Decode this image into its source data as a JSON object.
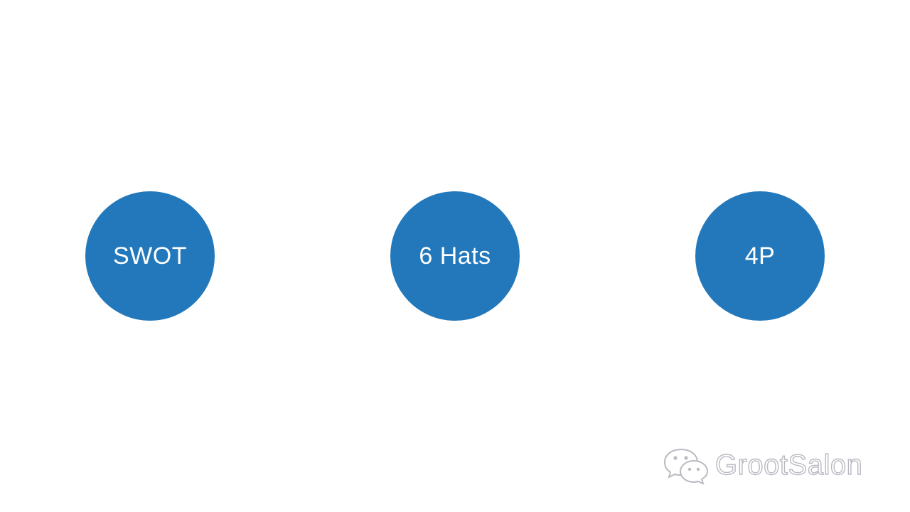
{
  "nodes": [
    {
      "label": "SWOT"
    },
    {
      "label": "6 Hats"
    },
    {
      "label": "4P"
    }
  ],
  "colors": {
    "node_fill": "#2278BA",
    "node_text": "#ffffff",
    "background": "#ffffff",
    "watermark": "#b9b9c2"
  },
  "watermark": {
    "icon": "wechat-icon",
    "text": "GrootSalon"
  }
}
